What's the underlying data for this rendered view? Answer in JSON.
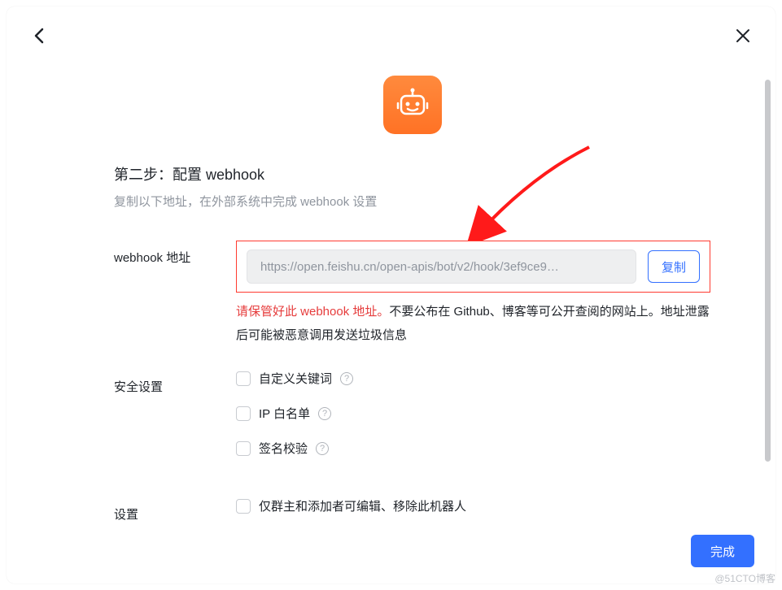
{
  "step": {
    "title": "第二步：配置 webhook",
    "subtitle": "复制以下地址，在外部系统中完成 webhook 设置"
  },
  "webhook": {
    "label": "webhook 地址",
    "url": "https://open.feishu.cn/open-apis/bot/v2/hook/3ef9ce9…",
    "copy_label": "复制",
    "warning_red": "请保管好此 webhook 地址。",
    "warning_rest": "不要公布在 Github、博客等可公开查阅的网站上。地址泄露后可能被恶意调用发送垃圾信息"
  },
  "security": {
    "label": "安全设置",
    "options": [
      {
        "label": "自定义关键词"
      },
      {
        "label": "IP 白名单"
      },
      {
        "label": "签名校验"
      }
    ]
  },
  "settings": {
    "label": "设置",
    "option": "仅群主和添加者可编辑、移除此机器人"
  },
  "done_label": "完成",
  "watermark": "@51CTO博客",
  "help_glyph": "?",
  "colors": {
    "primary": "#3370ff",
    "danger": "#e63c3c",
    "highlight_border": "#ff3b30",
    "bot_bg": "#ff7a2e"
  }
}
